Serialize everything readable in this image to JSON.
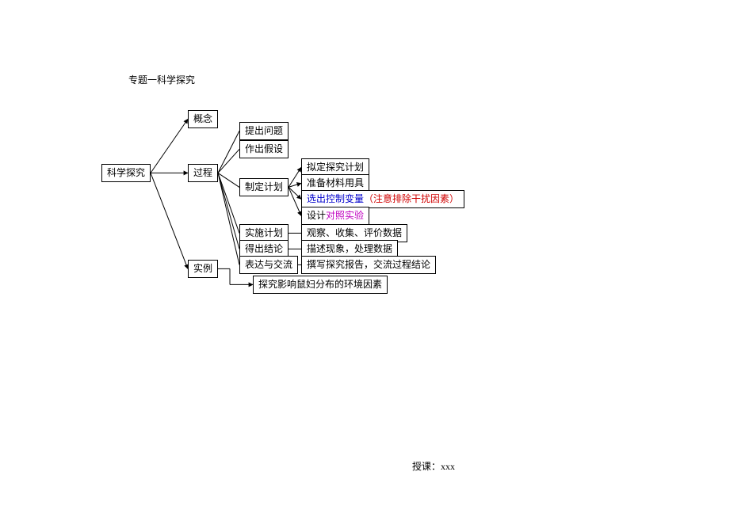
{
  "title": "专题一科学探究",
  "root": "科学探究",
  "branches": {
    "concept": "概念",
    "process": "过程",
    "example": "实例"
  },
  "process_steps": {
    "s1": "提出问题",
    "s2": "作出假设",
    "s3": "制定计划",
    "s4": "实施计划",
    "s5": "得出结论",
    "s6": "表达与交流"
  },
  "plan_details": {
    "d1": "拟定探究计划",
    "d2": "准备材料用具",
    "d3_html": "<span class='blue'>选出控制变量</span><span class='red'>（注意排除干扰因素）</span>",
    "d4_html": "设计<span class='magenta'>对照实验</span>"
  },
  "step_details": {
    "s4d": "观察、收集、评价数据",
    "s5d": "描述现象，处理数据",
    "s6d": "撰写探究报告，交流过程结论"
  },
  "example_detail": "探究影响鼠妇分布的环境因素",
  "footer": "授课：xxx"
}
